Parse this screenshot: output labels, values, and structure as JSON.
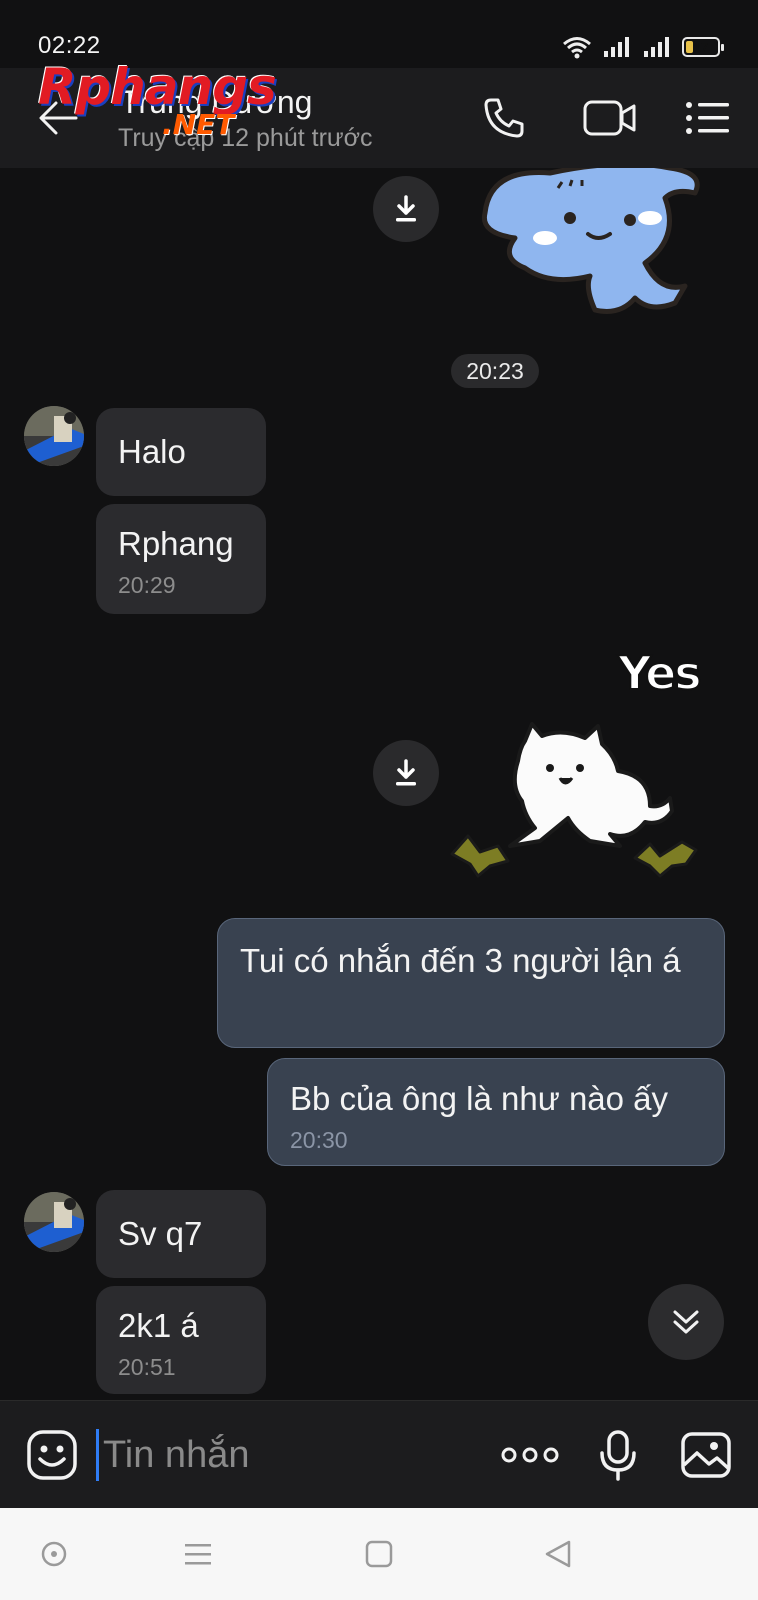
{
  "status_bar": {
    "time": "02:22",
    "battery_level": "17",
    "icons": [
      "wifi-icon",
      "signal-icon",
      "signal-icon",
      "battery-icon"
    ]
  },
  "header": {
    "contact_name": "Trung Dương",
    "contact_status": "Truy cập 12 phút trước",
    "watermark": {
      "brand": "Rphangs",
      "suffix": ".NET"
    },
    "icons": [
      "back-arrow-icon",
      "phone-icon",
      "video-call-icon",
      "menu-list-icon"
    ]
  },
  "chat": {
    "time_separator": "20:23",
    "incoming_group_1": {
      "messages": [
        {
          "text": "Halo"
        },
        {
          "text": "Rphang",
          "time": "20:29"
        }
      ]
    },
    "sticker_caption": "Yes",
    "outgoing_group": {
      "messages": [
        {
          "text": "Tui có nhắn đến 3 người lận á"
        },
        {
          "text": "Bb của ông là như nào ấy",
          "time": "20:30"
        }
      ]
    },
    "incoming_group_2": {
      "messages": [
        {
          "text": "Sv q7"
        },
        {
          "text": "2k1 á",
          "time": "20:51"
        }
      ]
    }
  },
  "input": {
    "placeholder": "Tin nhắn",
    "icons": [
      "emoji-icon",
      "more-dots-icon",
      "microphone-icon",
      "image-icon"
    ]
  },
  "nav": {
    "icons": [
      "nav-circle-icon",
      "nav-menu-icon",
      "nav-home-icon",
      "nav-back-icon"
    ]
  },
  "colors": {
    "background": "#111112",
    "header": "#1c1c1e",
    "incoming_bubble": "#2b2b2e",
    "outgoing_bubble": "#394250",
    "accent": "#2f7df6"
  }
}
